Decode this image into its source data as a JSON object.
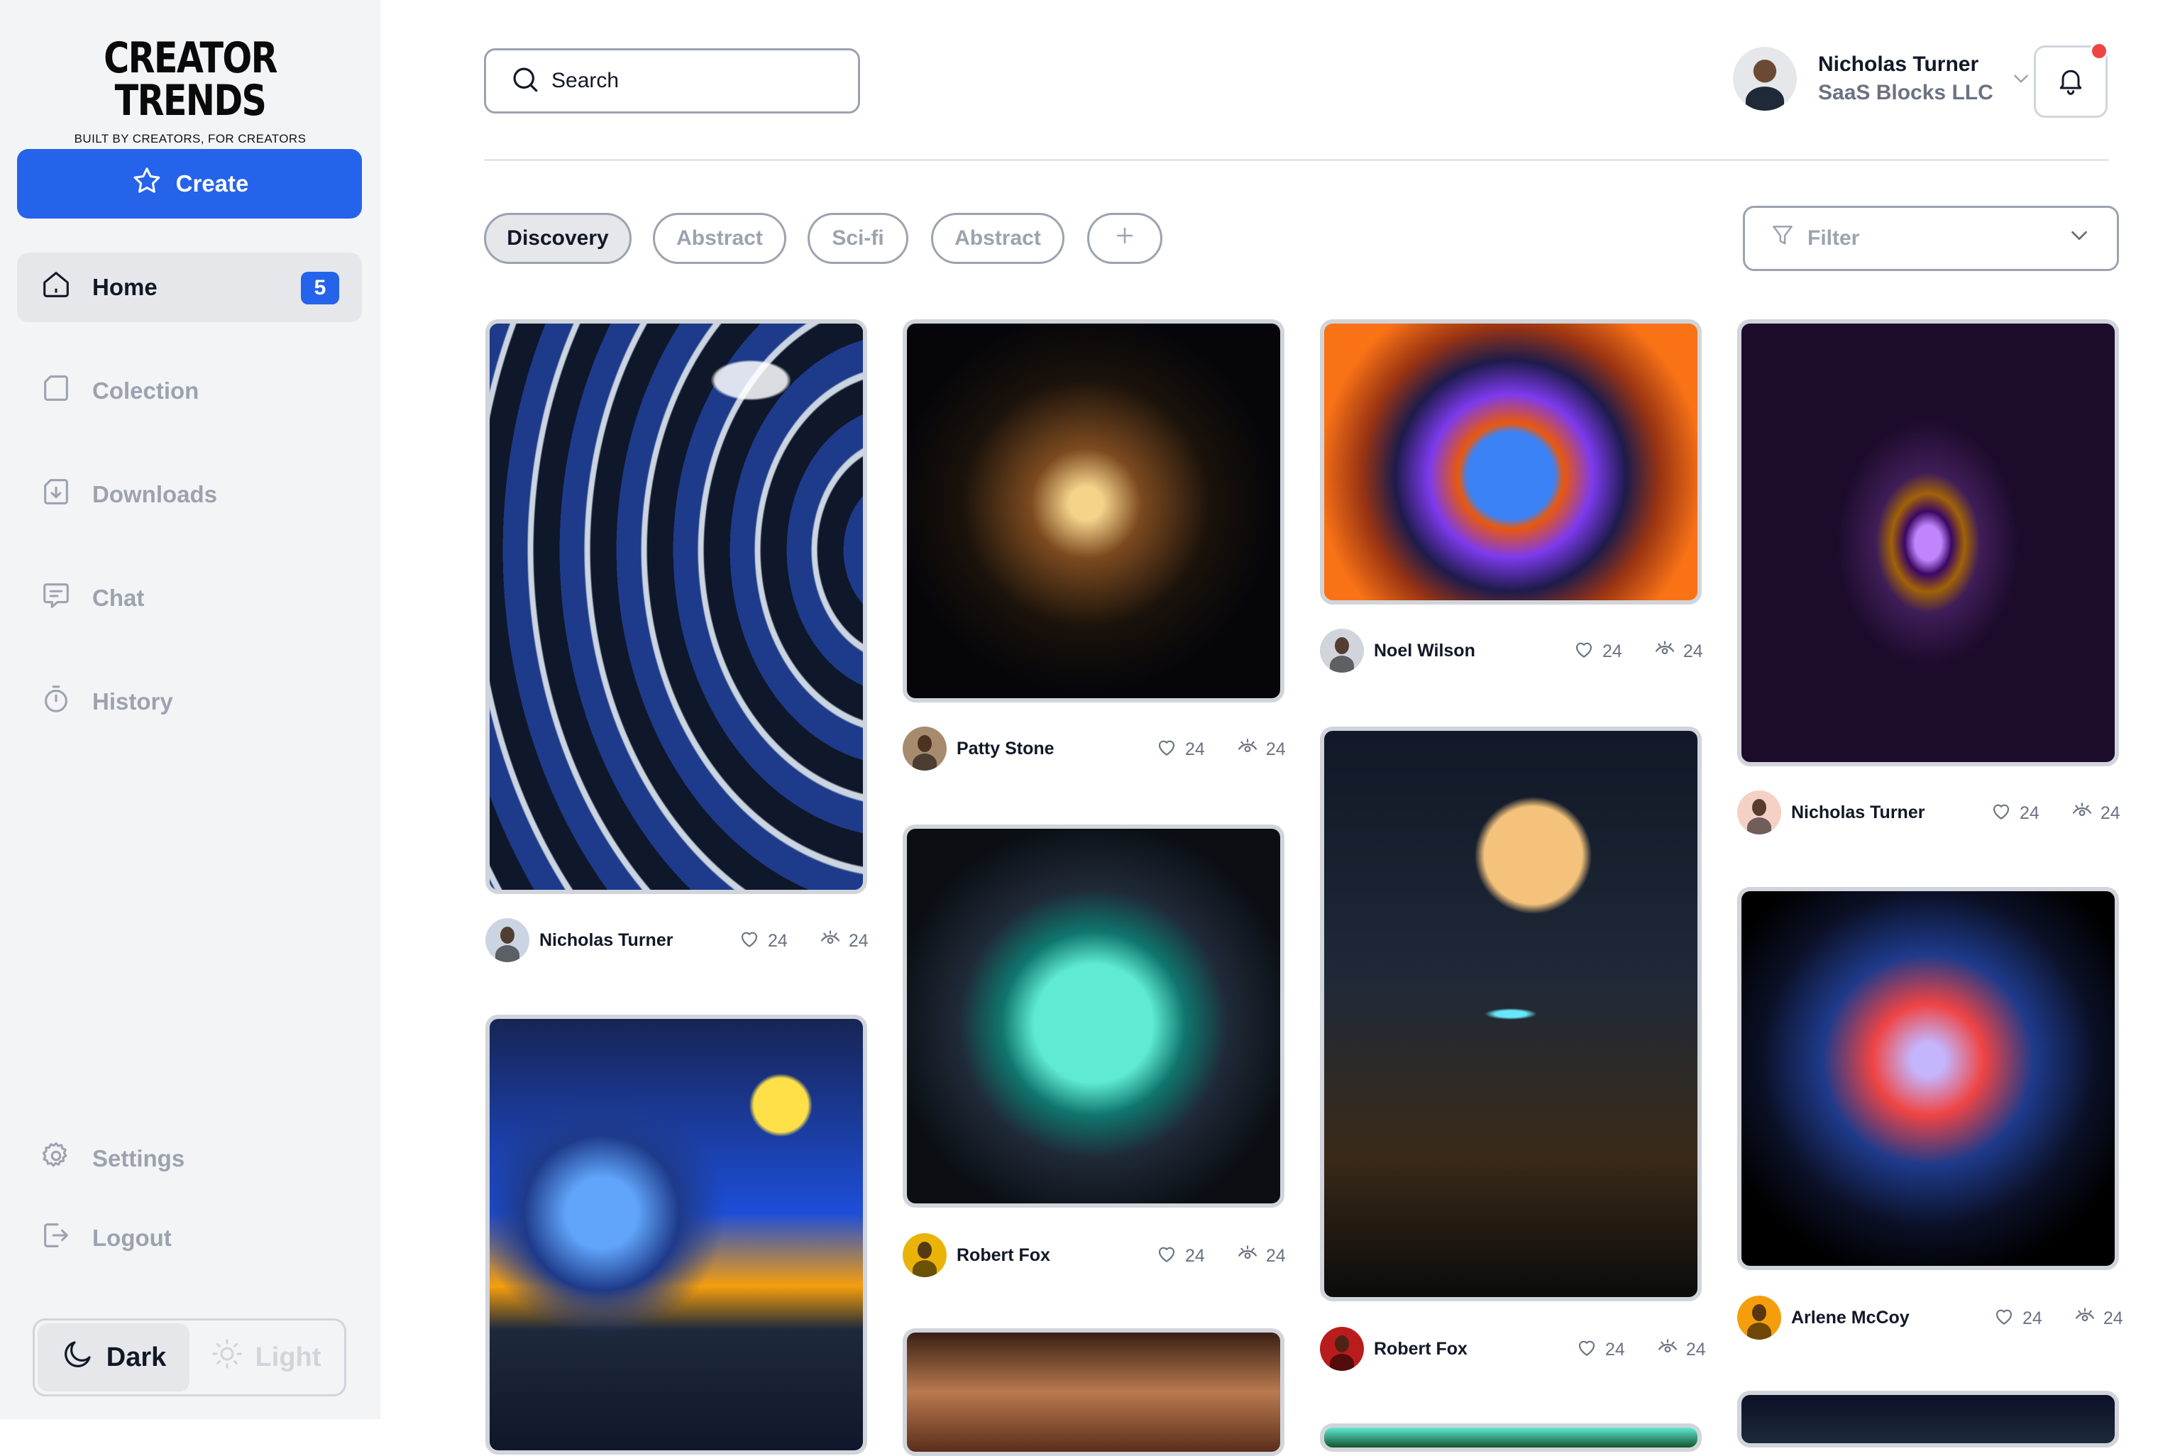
{
  "brand": {
    "title": "CREATOR TRENDS",
    "tagline": "BUILT BY CREATORS, FOR CREATORS"
  },
  "sidebar": {
    "create_label": "Create",
    "items": [
      {
        "label": "Home",
        "badge": "5",
        "icon": "home-icon",
        "active": true
      },
      {
        "label": "Colection",
        "icon": "collection-icon"
      },
      {
        "label": "Downloads",
        "icon": "downloads-icon"
      },
      {
        "label": "Chat",
        "icon": "chat-icon"
      },
      {
        "label": "History",
        "icon": "history-icon"
      }
    ],
    "bottom_items": [
      {
        "label": "Settings",
        "icon": "settings-icon"
      },
      {
        "label": "Logout",
        "icon": "logout-icon"
      }
    ],
    "theme": {
      "dark_label": "Dark",
      "light_label": "Light",
      "selected": "Dark"
    }
  },
  "header": {
    "search_placeholder": "Search",
    "user": {
      "name": "Nicholas Turner",
      "company": "SaaS Blocks LLC"
    },
    "notifications_unread": true
  },
  "filters": {
    "chips": [
      "Discovery",
      "Abstract",
      "Sci-fi",
      "Abstract"
    ],
    "active_chip": "Discovery",
    "filter_placeholder": "Filter"
  },
  "colors": {
    "accent": "#2563eb",
    "notification": "#ef4444",
    "sidebar_bg": "#f3f4f6"
  },
  "cards": [
    {
      "author": "Nicholas Turner",
      "likes": "24",
      "views": "24",
      "art": "waves"
    },
    {
      "author": "Patty Stone",
      "likes": "24",
      "views": "24",
      "art": "surfer"
    },
    {
      "author": "Noel Wilson",
      "likes": "24",
      "views": "24",
      "art": "face"
    },
    {
      "author": "Nicholas Turner",
      "likes": "24",
      "views": "24",
      "art": "gameboy"
    },
    {
      "author": "",
      "likes": "",
      "views": "",
      "art": "starry"
    },
    {
      "author": "Robert Fox",
      "likes": "24",
      "views": "24",
      "art": "monster"
    },
    {
      "author": "Robert Fox",
      "likes": "24",
      "views": "24",
      "art": "moons"
    },
    {
      "author": "Arlene McCoy",
      "likes": "24",
      "views": "24",
      "art": "galaxy"
    }
  ]
}
